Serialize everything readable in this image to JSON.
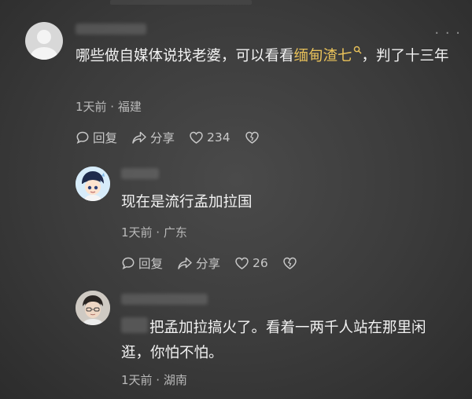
{
  "comments": [
    {
      "text_before": "哪些做自媒体说找老婆，可以看看",
      "link_text": "缅甸渣七",
      "text_after": "，判了十三年",
      "time": "1天前 · 福建",
      "reply_label": "回复",
      "share_label": "分享",
      "likes": "234"
    },
    {
      "text": "现在是流行孟加拉国",
      "time": "1天前 · 广东",
      "reply_label": "回复",
      "share_label": "分享",
      "likes": "26"
    },
    {
      "text": "把孟加拉搞火了。看着一两千人站在那里闲逛，你怕不怕。",
      "time": "1天前 · 湖南"
    }
  ],
  "icons": {
    "more": "more-dots-icon",
    "reply": "comment-bubble-icon",
    "share": "share-arrow-icon",
    "like": "heart-icon",
    "dislike": "broken-heart-icon",
    "search": "search-icon"
  },
  "colors": {
    "link": "#e8c15a",
    "background": "#3b3b3b"
  }
}
